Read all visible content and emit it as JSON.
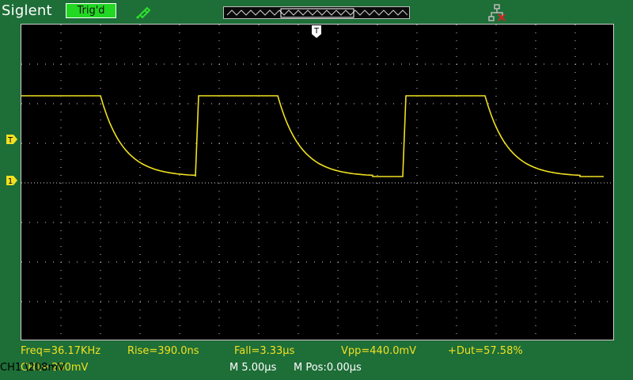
{
  "header": {
    "brand": "Siglent",
    "trigger_status": "Trig'd",
    "probe_icon": "probe-icon",
    "network_icon": "network-disconnected-icon"
  },
  "markers": {
    "trigger_level_marker": "T",
    "channel1_marker": "1",
    "trigger_position_marker": "T"
  },
  "measurements": {
    "freq": "Freq=36.17KHz",
    "rise": "Rise=390.0ns",
    "fall": "Fall=3.33µs",
    "vpp": "Vpp=440.0mV",
    "duty": "+Dut=57.58%"
  },
  "status_bar": {
    "ch1_scale": "CH1═ 200mV",
    "timebase": "M 5.00µs",
    "menu_position": "M Pos:0.00µs",
    "trigger_level": "CH1 \\208mV"
  },
  "colors": {
    "background": "#1e6e38",
    "trace": "#f0e020",
    "trigger_label_bg": "#22d822",
    "grid": "#d0d0d0",
    "screen": "#000000"
  }
}
